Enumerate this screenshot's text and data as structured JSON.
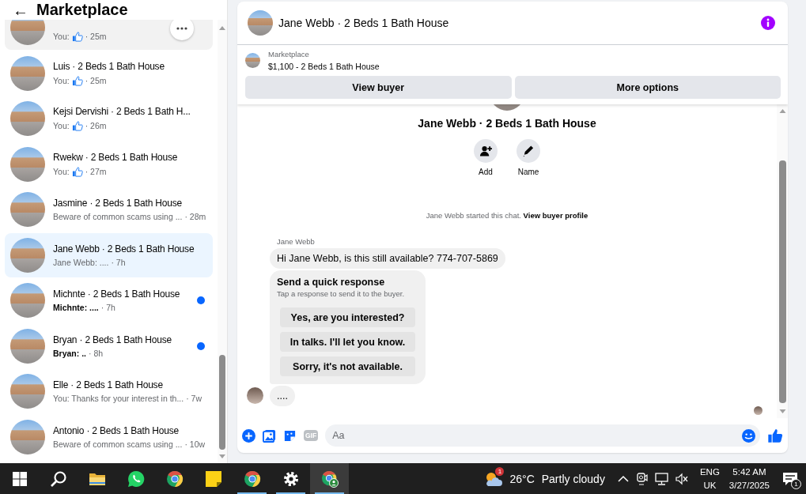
{
  "sidebar": {
    "back": "←",
    "title": "Marketplace"
  },
  "conversations": [
    {
      "kind": "like",
      "preview": "You:",
      "time": "· 25m",
      "unread": false,
      "selected": false,
      "hovered": true
    },
    {
      "name": "Luis · 2 Beds 1 Bath House",
      "kind": "like",
      "preview": "You:",
      "time": "· 25m",
      "unread": false,
      "selected": false,
      "hovered": false
    },
    {
      "name": "Kejsi Dervishi · 2 Beds 1 Bath H...",
      "kind": "like",
      "preview": "You:",
      "time": "· 26m",
      "unread": false,
      "selected": false,
      "hovered": false
    },
    {
      "name": "Rwekw · 2 Beds 1 Bath House",
      "kind": "like",
      "preview": "You:",
      "time": "· 27m",
      "unread": false,
      "selected": false,
      "hovered": false
    },
    {
      "name": "Jasmine · 2 Beds 1 Bath House",
      "kind": "text",
      "preview": "Beware of common scams using ...",
      "time": "· 28m",
      "unread": false,
      "selected": false,
      "hovered": false
    },
    {
      "name": "Jane Webb · 2 Beds 1 Bath House",
      "kind": "text",
      "preview": "Jane Webb: ....",
      "time": "· 7h",
      "unread": false,
      "selected": true,
      "hovered": false
    },
    {
      "name": "Michnte · 2 Beds 1 Bath House",
      "kind": "text",
      "preview": "Michnte: ....",
      "time": "· 7h",
      "unread": true,
      "selected": false,
      "hovered": false
    },
    {
      "name": "Bryan · 2 Beds 1 Bath House",
      "kind": "text",
      "preview": "Bryan: ..",
      "time": "· 8h",
      "unread": true,
      "selected": false,
      "hovered": false
    },
    {
      "name": "Elle · 2 Beds 1 Bath House",
      "kind": "text",
      "preview": "You: Thanks for your interest in th...",
      "time": "· 7w",
      "unread": false,
      "selected": false,
      "hovered": false
    },
    {
      "name": "Antonio · 2 Beds 1 Bath House",
      "kind": "text",
      "preview": "Beware of common scams using ...",
      "time": "· 10w",
      "unread": false,
      "selected": false,
      "hovered": false
    }
  ],
  "chat": {
    "title": "Jane Webb · 2 Beds 1 Bath House",
    "listing": {
      "source": "Marketplace",
      "summary": "$1,100 - 2 Beds 1 Bath House"
    },
    "actions": [
      "View buyer",
      "More options"
    ],
    "profile": {
      "title": "Jane Webb · 2 Beds 1 Bath House",
      "actions": [
        {
          "kind": "add",
          "label": "Add"
        },
        {
          "kind": "name",
          "label": "Name"
        }
      ]
    },
    "system_note": {
      "text": "Jane Webb started this chat.",
      "link": "View buyer profile"
    },
    "messages": [
      {
        "kind": "text",
        "sender": "Jane Webb",
        "text": "Hi Jane Webb, is this still available? 774-707-5869",
        "avatar": false
      },
      {
        "kind": "quick_responses",
        "title": "Send a quick response",
        "subtitle": "Tap a response to send it to the buyer.",
        "options": [
          "Yes, are you interested?",
          "In talks. I'll let you know.",
          "Sorry, it's not available."
        ]
      },
      {
        "kind": "text",
        "text": "....",
        "avatar": true
      }
    ],
    "composer": {
      "gif": "GIF",
      "placeholder": "Aa"
    }
  },
  "taskbar": {
    "apps": [
      {
        "kind": "start",
        "running": false,
        "active": false
      },
      {
        "kind": "search",
        "running": false,
        "active": false
      },
      {
        "kind": "files",
        "running": false,
        "active": false
      },
      {
        "kind": "whatsapp",
        "running": false,
        "active": false
      },
      {
        "kind": "chrome",
        "running": false,
        "active": false
      },
      {
        "kind": "notes",
        "running": false,
        "active": false
      },
      {
        "kind": "chrome",
        "running": true,
        "active": false
      },
      {
        "kind": "settings",
        "running": true,
        "active": false
      },
      {
        "kind": "chrome-profile",
        "running": true,
        "active": true
      }
    ],
    "weather": {
      "badge": "1",
      "temperature": "26°C",
      "condition": "Partly cloudy"
    },
    "language": {
      "code": "ENG",
      "region": "UK"
    },
    "clock": {
      "time": "5:42 AM",
      "date": "3/27/2025"
    },
    "notifications": {
      "count": "1"
    }
  }
}
